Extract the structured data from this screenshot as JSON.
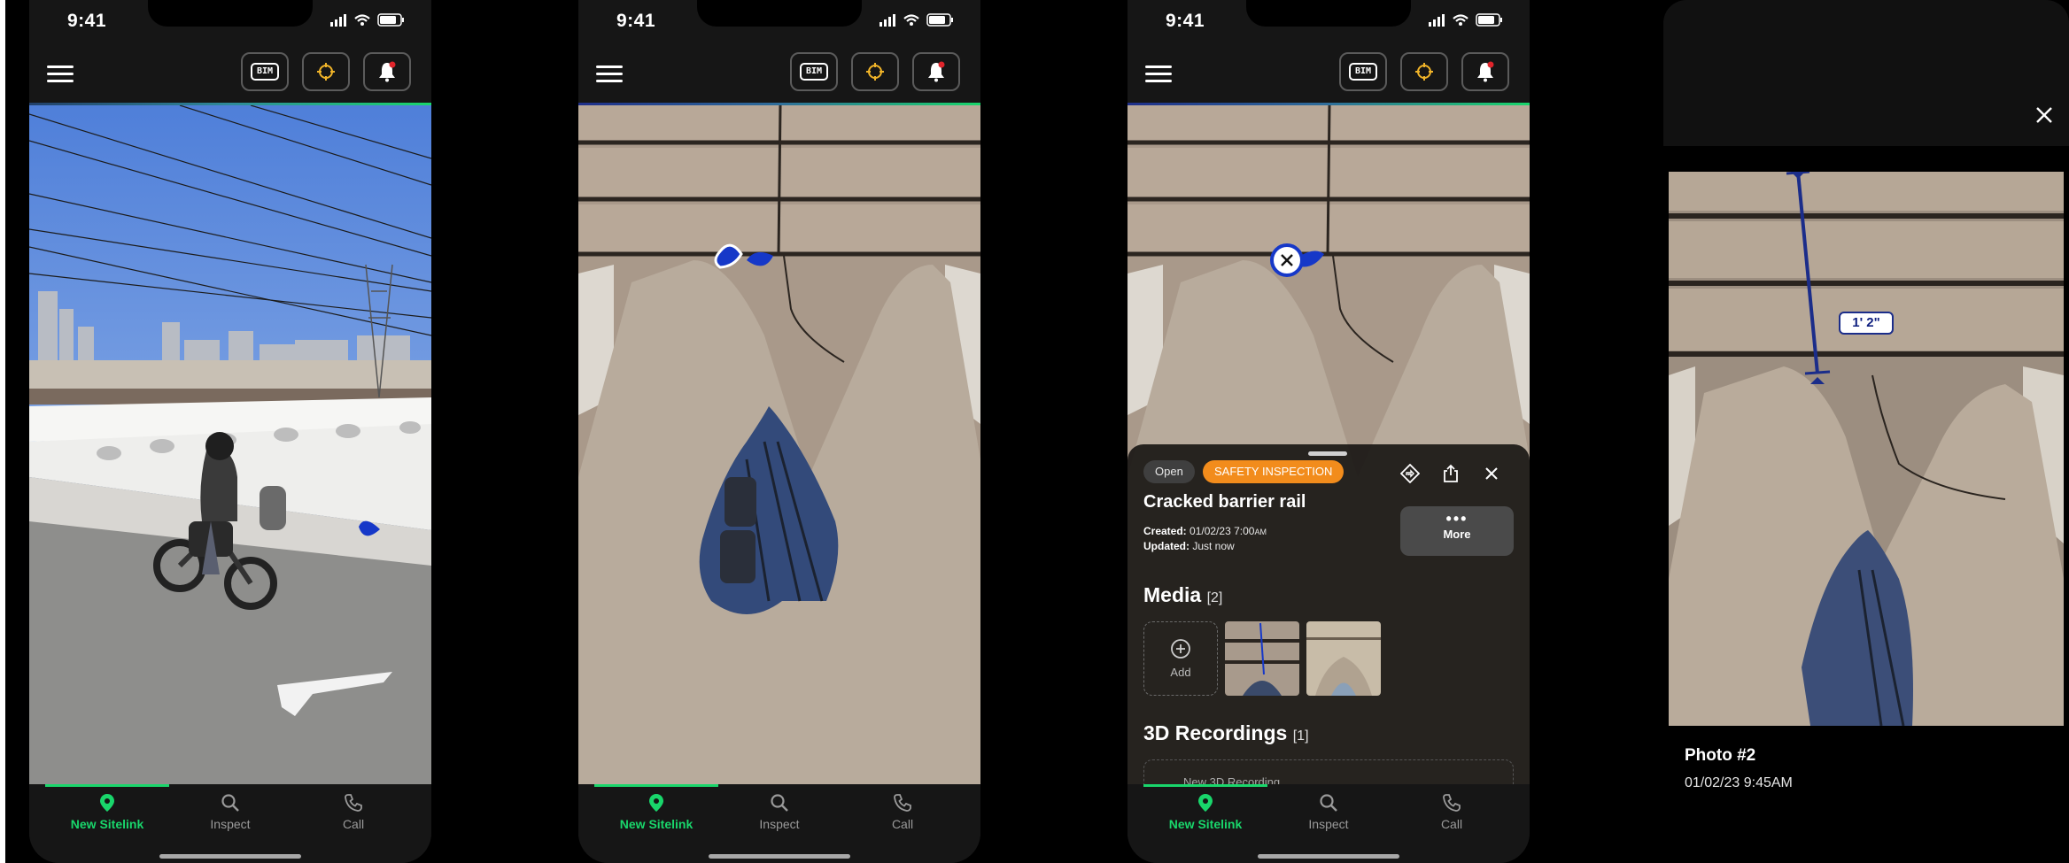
{
  "status": {
    "time": "9:41"
  },
  "toolbar": {
    "bim_label": "BIM"
  },
  "tabs": [
    {
      "label": "New Sitelink",
      "icon": "map-pin-icon"
    },
    {
      "label": "Inspect",
      "icon": "search-icon"
    },
    {
      "label": "Call",
      "icon": "phone-icon"
    }
  ],
  "issue": {
    "status_chip": "Open",
    "type_chip": "SAFETY INSPECTION",
    "title": "Cracked barrier rail",
    "created_label": "Created:",
    "created_value": "01/02/23 7:00",
    "created_suffix": "AM",
    "updated_label": "Updated:",
    "updated_value": "Just now",
    "more_label": "More",
    "media_heading": "Media",
    "media_count": "[2]",
    "add_label": "Add",
    "recordings_heading": "3D Recordings",
    "recordings_count": "[1]",
    "recordings_add_label": "New 3D Recording"
  },
  "viewer": {
    "title": "Photo #2",
    "date": "01/02/23 9:45AM",
    "measurement": "1' 2\""
  },
  "colors": {
    "accent_green": "#19d66b",
    "chip_open": "#3f3f3f",
    "chip_safety": "#f28c1c",
    "pin_blue": "#1638c8",
    "measure_blue": "#1b2d8a"
  }
}
